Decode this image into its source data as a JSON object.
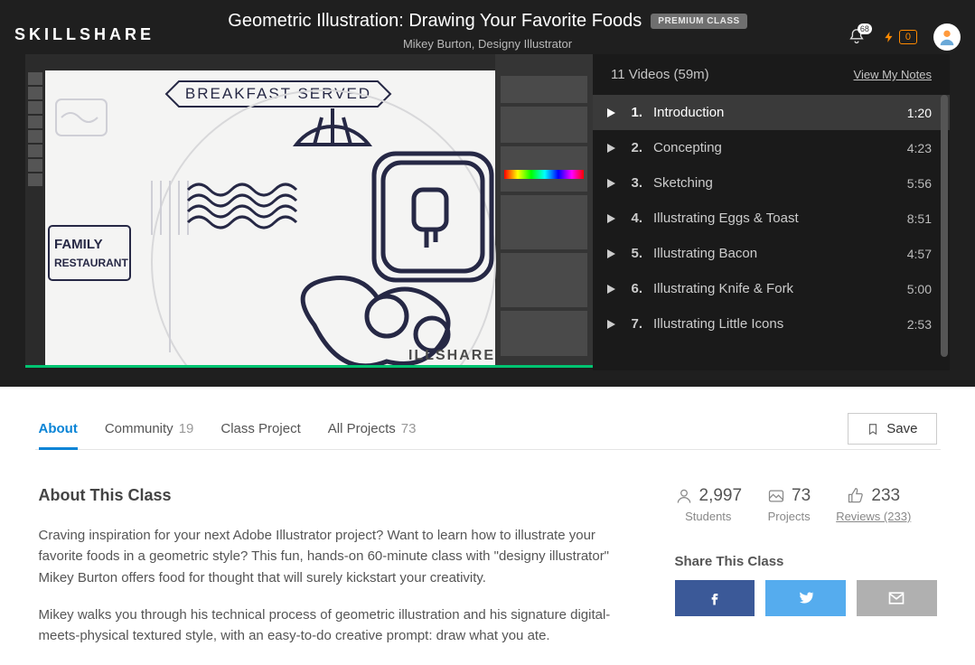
{
  "header": {
    "logo": "SKILLSHARE",
    "title": "Geometric Illustration: Drawing Your Favorite Foods",
    "badge": "PREMIUM CLASS",
    "subtitle": "Mikey Burton, Designy Illustrator",
    "notif_count": "68",
    "bolt_count": "0"
  },
  "playlist": {
    "summary": "11 Videos (59m)",
    "notes_link": "View My Notes",
    "items": [
      {
        "num": "1.",
        "title": "Introduction",
        "dur": "1:20",
        "active": true
      },
      {
        "num": "2.",
        "title": "Concepting",
        "dur": "4:23",
        "active": false
      },
      {
        "num": "3.",
        "title": "Sketching",
        "dur": "5:56",
        "active": false
      },
      {
        "num": "4.",
        "title": "Illustrating Eggs & Toast",
        "dur": "8:51",
        "active": false
      },
      {
        "num": "5.",
        "title": "Illustrating Bacon",
        "dur": "4:57",
        "active": false
      },
      {
        "num": "6.",
        "title": "Illustrating Knife & Fork",
        "dur": "5:00",
        "active": false
      },
      {
        "num": "7.",
        "title": "Illustrating Little Icons",
        "dur": "2:53",
        "active": false
      }
    ]
  },
  "tabs": {
    "about": "About",
    "community": "Community",
    "community_count": "19",
    "class_project": "Class Project",
    "all_projects": "All Projects",
    "all_projects_count": "73",
    "save": "Save"
  },
  "about": {
    "heading": "About This Class",
    "p1": "Craving inspiration for your next Adobe Illustrator project? Want to learn how to illustrate your favorite foods in a geometric style? This fun, hands-on 60-minute class with \"designy illustrator\" Mikey Burton offers food for thought that will surely kickstart your creativity.",
    "p2": "Mikey walks you through his technical process of geometric illustration and his signature digital-meets-physical textured style, with an easy-to-do creative prompt: draw what you ate."
  },
  "stats": {
    "students": "2,997",
    "students_lbl": "Students",
    "projects": "73",
    "projects_lbl": "Projects",
    "reviews": "233",
    "reviews_lbl": "Reviews (233)"
  },
  "share": {
    "heading": "Share This Class"
  },
  "video_preview": {
    "banner": "BREAKFAST SERVED",
    "sign1": "FAMILY",
    "sign2": "RESTAURANT",
    "watermark": "ILLSHARE"
  }
}
